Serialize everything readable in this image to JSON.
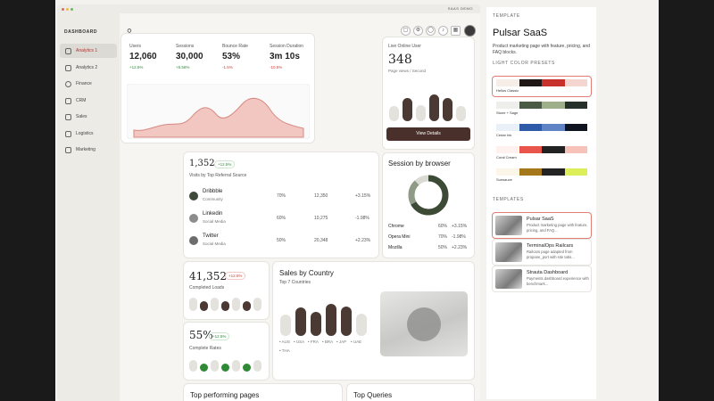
{
  "window": {
    "title": "SAAS DEMO"
  },
  "sidebar": {
    "heading": "DASHBOARD",
    "items": [
      {
        "label": "Analytics 1",
        "icon": "analytics-icon",
        "active": true
      },
      {
        "label": "Analytics 2",
        "icon": "analytics-icon",
        "active": false
      },
      {
        "label": "Finance",
        "icon": "dollar-icon",
        "active": false
      },
      {
        "label": "CRM",
        "icon": "chat-icon",
        "active": false
      },
      {
        "label": "Sales",
        "icon": "bag-icon",
        "active": false
      },
      {
        "label": "Logistics",
        "icon": "truck-icon",
        "active": false
      },
      {
        "label": "Marketing",
        "icon": "megaphone-icon",
        "active": false
      }
    ]
  },
  "kpis": [
    {
      "label": "Users",
      "value": "12,060",
      "delta": "+12.5%",
      "trend": "up"
    },
    {
      "label": "Sessions",
      "value": "30,000",
      "delta": "+5.56%",
      "trend": "up"
    },
    {
      "label": "Bounce Rate",
      "value": "53%",
      "delta": "-1.5%",
      "trend": "down"
    },
    {
      "label": "Session Duration",
      "value": "3m 10s",
      "delta": "-10.5%",
      "trend": "down"
    }
  ],
  "live": {
    "label": "Live Online User",
    "value": "348",
    "sub": "Page views / Second",
    "bar_levels": [
      0.3,
      0.75,
      0.35,
      1.0,
      0.75,
      0.3
    ],
    "button": "View Details"
  },
  "referral": {
    "value": "1,352",
    "badge": "+12.5%",
    "label": "Visits by Top Referral Source",
    "rows": [
      {
        "name": "Dribbble",
        "sub": "Community",
        "pct": "70%",
        "count": "12,350",
        "delta": "+3.15%",
        "trend": "up"
      },
      {
        "name": "Linkedin",
        "sub": "Social Media",
        "pct": "60%",
        "count": "10,275",
        "delta": "-1.98%",
        "trend": "down"
      },
      {
        "name": "Twitter",
        "sub": "Social Media",
        "pct": "50%",
        "count": "20,348",
        "delta": "+2.23%",
        "trend": "up"
      }
    ]
  },
  "browser": {
    "title": "Session by browser",
    "rows": [
      {
        "name": "Chrome",
        "pct": "60%",
        "delta": "+3.15%",
        "trend": "up"
      },
      {
        "name": "Opera Mini",
        "pct": "70%",
        "delta": "-1.98%",
        "trend": "down"
      },
      {
        "name": "Mozilla",
        "pct": "50%",
        "delta": "+2.23%",
        "trend": "up"
      }
    ]
  },
  "loads": {
    "value": "41,352",
    "badge": "+12.5%",
    "label": "Completed Loads"
  },
  "rates": {
    "value": "55%",
    "badge": "+12.5%",
    "label": "Complete Rates"
  },
  "country": {
    "title": "Sales by Country",
    "sub": "Top 7 Countries",
    "legend": [
      "AUS",
      "USA",
      "FRA",
      "BRA",
      "JAP",
      "UAE",
      "THA"
    ],
    "bar_levels": [
      0.45,
      0.8,
      0.6,
      1.0,
      0.85,
      0.5
    ]
  },
  "bottom": {
    "left_title": "Top performing pages",
    "right_title": "Top Queries"
  },
  "panel": {
    "template_head": "TEMPLATE",
    "title": "Pulsar SaaS",
    "desc": "Product marketing page with feature, pricing, and FAQ blocks.",
    "presets_head": "LIGHT COLOR PRESETS",
    "presets": [
      {
        "name": "Helios Classic",
        "colors": [
          "#f6ede6",
          "#1f1716",
          "#c8302c",
          "#f5d5cf"
        ],
        "selected": true
      },
      {
        "name": "Stone + Sage",
        "colors": [
          "#eeeeea",
          "#4a5a45",
          "#9db08a",
          "#25302a"
        ],
        "selected": false
      },
      {
        "name": "Cedar Ink",
        "colors": [
          "#eaf0f8",
          "#2f5aa8",
          "#5f84c6",
          "#0f1420"
        ],
        "selected": false
      },
      {
        "name": "Coral Cream",
        "colors": [
          "#fff2ee",
          "#e8554a",
          "#222222",
          "#f7c2b8"
        ],
        "selected": false
      },
      {
        "name": "Sunsauce",
        "colors": [
          "#fbf6e7",
          "#a4781a",
          "#232323",
          "#dcef5a"
        ],
        "selected": false
      }
    ],
    "templates_head": "TEMPLATES",
    "templates": [
      {
        "name": "Pulsar SaaS",
        "desc": "Product marketing page with feature, pricing, and FAQ...",
        "selected": true
      },
      {
        "name": "TerminalOps Railcars",
        "desc": "Railcars page adapted from propane_port with site tabs...",
        "selected": false
      },
      {
        "name": "Strauta Dashboard",
        "desc": "Payments dashboard experience with benchmark...",
        "selected": false
      }
    ]
  },
  "colors": {
    "accent": "#b5342d",
    "dark": "#4a302a",
    "positive": "#2e8b3d",
    "negative": "#c7473e"
  }
}
